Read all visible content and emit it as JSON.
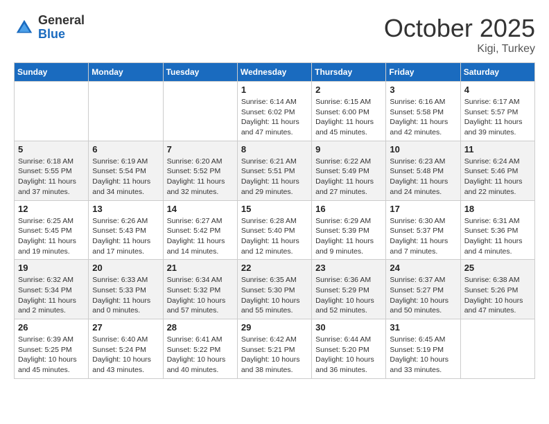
{
  "header": {
    "logo_general": "General",
    "logo_blue": "Blue",
    "month_title": "October 2025",
    "location": "Kigi, Turkey"
  },
  "weekdays": [
    "Sunday",
    "Monday",
    "Tuesday",
    "Wednesday",
    "Thursday",
    "Friday",
    "Saturday"
  ],
  "weeks": [
    [
      {
        "day": "",
        "info": ""
      },
      {
        "day": "",
        "info": ""
      },
      {
        "day": "",
        "info": ""
      },
      {
        "day": "1",
        "info": "Sunrise: 6:14 AM\nSunset: 6:02 PM\nDaylight: 11 hours and 47 minutes."
      },
      {
        "day": "2",
        "info": "Sunrise: 6:15 AM\nSunset: 6:00 PM\nDaylight: 11 hours and 45 minutes."
      },
      {
        "day": "3",
        "info": "Sunrise: 6:16 AM\nSunset: 5:58 PM\nDaylight: 11 hours and 42 minutes."
      },
      {
        "day": "4",
        "info": "Sunrise: 6:17 AM\nSunset: 5:57 PM\nDaylight: 11 hours and 39 minutes."
      }
    ],
    [
      {
        "day": "5",
        "info": "Sunrise: 6:18 AM\nSunset: 5:55 PM\nDaylight: 11 hours and 37 minutes."
      },
      {
        "day": "6",
        "info": "Sunrise: 6:19 AM\nSunset: 5:54 PM\nDaylight: 11 hours and 34 minutes."
      },
      {
        "day": "7",
        "info": "Sunrise: 6:20 AM\nSunset: 5:52 PM\nDaylight: 11 hours and 32 minutes."
      },
      {
        "day": "8",
        "info": "Sunrise: 6:21 AM\nSunset: 5:51 PM\nDaylight: 11 hours and 29 minutes."
      },
      {
        "day": "9",
        "info": "Sunrise: 6:22 AM\nSunset: 5:49 PM\nDaylight: 11 hours and 27 minutes."
      },
      {
        "day": "10",
        "info": "Sunrise: 6:23 AM\nSunset: 5:48 PM\nDaylight: 11 hours and 24 minutes."
      },
      {
        "day": "11",
        "info": "Sunrise: 6:24 AM\nSunset: 5:46 PM\nDaylight: 11 hours and 22 minutes."
      }
    ],
    [
      {
        "day": "12",
        "info": "Sunrise: 6:25 AM\nSunset: 5:45 PM\nDaylight: 11 hours and 19 minutes."
      },
      {
        "day": "13",
        "info": "Sunrise: 6:26 AM\nSunset: 5:43 PM\nDaylight: 11 hours and 17 minutes."
      },
      {
        "day": "14",
        "info": "Sunrise: 6:27 AM\nSunset: 5:42 PM\nDaylight: 11 hours and 14 minutes."
      },
      {
        "day": "15",
        "info": "Sunrise: 6:28 AM\nSunset: 5:40 PM\nDaylight: 11 hours and 12 minutes."
      },
      {
        "day": "16",
        "info": "Sunrise: 6:29 AM\nSunset: 5:39 PM\nDaylight: 11 hours and 9 minutes."
      },
      {
        "day": "17",
        "info": "Sunrise: 6:30 AM\nSunset: 5:37 PM\nDaylight: 11 hours and 7 minutes."
      },
      {
        "day": "18",
        "info": "Sunrise: 6:31 AM\nSunset: 5:36 PM\nDaylight: 11 hours and 4 minutes."
      }
    ],
    [
      {
        "day": "19",
        "info": "Sunrise: 6:32 AM\nSunset: 5:34 PM\nDaylight: 11 hours and 2 minutes."
      },
      {
        "day": "20",
        "info": "Sunrise: 6:33 AM\nSunset: 5:33 PM\nDaylight: 11 hours and 0 minutes."
      },
      {
        "day": "21",
        "info": "Sunrise: 6:34 AM\nSunset: 5:32 PM\nDaylight: 10 hours and 57 minutes."
      },
      {
        "day": "22",
        "info": "Sunrise: 6:35 AM\nSunset: 5:30 PM\nDaylight: 10 hours and 55 minutes."
      },
      {
        "day": "23",
        "info": "Sunrise: 6:36 AM\nSunset: 5:29 PM\nDaylight: 10 hours and 52 minutes."
      },
      {
        "day": "24",
        "info": "Sunrise: 6:37 AM\nSunset: 5:27 PM\nDaylight: 10 hours and 50 minutes."
      },
      {
        "day": "25",
        "info": "Sunrise: 6:38 AM\nSunset: 5:26 PM\nDaylight: 10 hours and 47 minutes."
      }
    ],
    [
      {
        "day": "26",
        "info": "Sunrise: 6:39 AM\nSunset: 5:25 PM\nDaylight: 10 hours and 45 minutes."
      },
      {
        "day": "27",
        "info": "Sunrise: 6:40 AM\nSunset: 5:24 PM\nDaylight: 10 hours and 43 minutes."
      },
      {
        "day": "28",
        "info": "Sunrise: 6:41 AM\nSunset: 5:22 PM\nDaylight: 10 hours and 40 minutes."
      },
      {
        "day": "29",
        "info": "Sunrise: 6:42 AM\nSunset: 5:21 PM\nDaylight: 10 hours and 38 minutes."
      },
      {
        "day": "30",
        "info": "Sunrise: 6:44 AM\nSunset: 5:20 PM\nDaylight: 10 hours and 36 minutes."
      },
      {
        "day": "31",
        "info": "Sunrise: 6:45 AM\nSunset: 5:19 PM\nDaylight: 10 hours and 33 minutes."
      },
      {
        "day": "",
        "info": ""
      }
    ]
  ]
}
